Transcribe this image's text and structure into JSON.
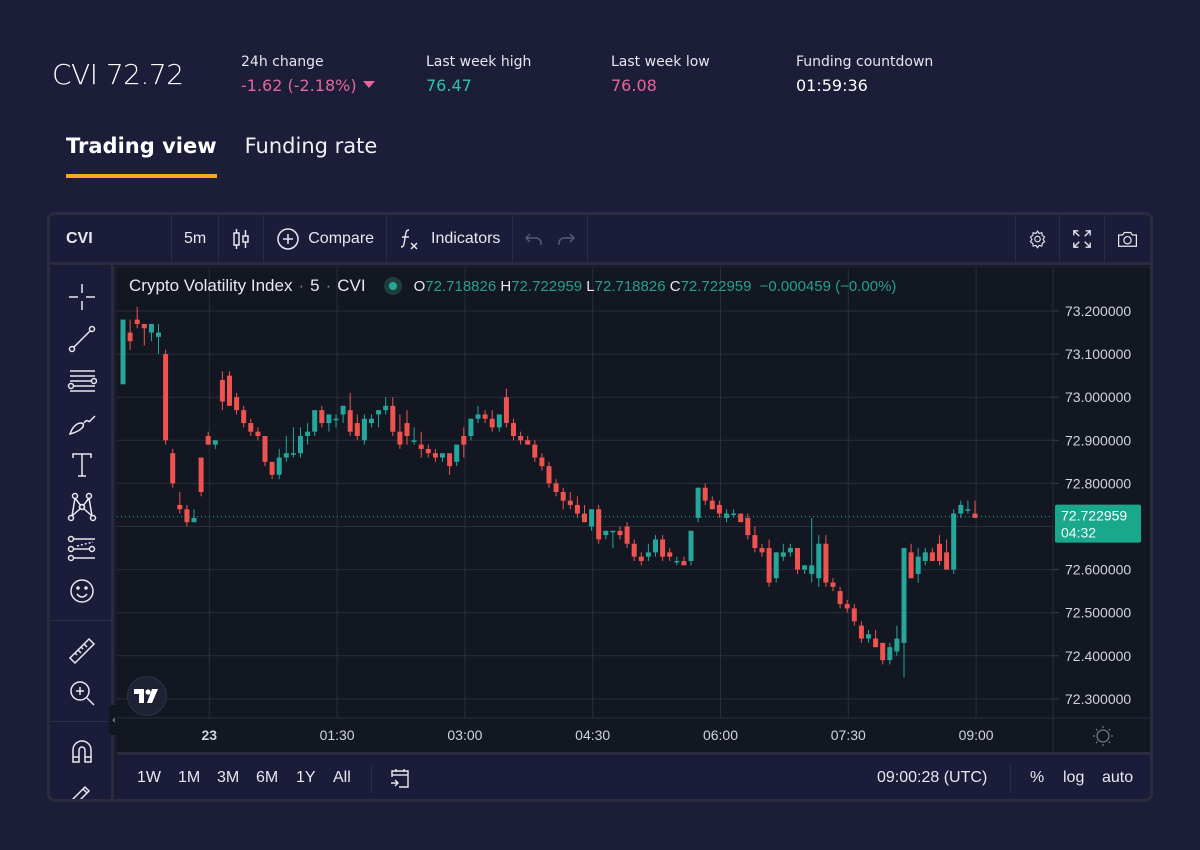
{
  "header": {
    "title": "CVI 72.72",
    "stats": [
      {
        "label": "24h change",
        "value": "-1.62 (-2.18%)",
        "trend": "down",
        "color": "#e6669a"
      },
      {
        "label": "Last week high",
        "value": "76.47",
        "color": "#2fc2a8"
      },
      {
        "label": "Last week low",
        "value": "76.08",
        "color": "#e6669a"
      },
      {
        "label": "Funding countdown",
        "value": "01:59:36",
        "color": "#ffffff"
      }
    ]
  },
  "tabs": [
    {
      "label": "Trading view",
      "active": true
    },
    {
      "label": "Funding rate",
      "active": false
    }
  ],
  "colors": {
    "accent": "#f6a623",
    "up": "#26a69a",
    "down": "#ef5350",
    "background": "#1c1d38",
    "plot": "#131722"
  },
  "toolbar": {
    "symbol": "CVI",
    "interval": "5m",
    "compare_label": "Compare",
    "indicators_label": "Indicators",
    "icons": [
      "candlestick-icon",
      "compare-plus-icon",
      "fx-icon",
      "undo-icon",
      "redo-icon",
      "settings-gear-icon",
      "fullscreen-icon",
      "camera-icon"
    ]
  },
  "left_tools": [
    "crosshair-icon",
    "trend-line-icon",
    "fib-lines-icon",
    "brush-icon",
    "text-icon",
    "pattern-icon",
    "prediction-icon",
    "emoji-icon",
    "ruler-icon",
    "zoom-in-icon",
    "magnet-icon",
    "pencil-lock-icon"
  ],
  "legend": {
    "name": "Crypto Volatility Index",
    "interval": "5",
    "symbol": "CVI",
    "o_label": "O",
    "o": "72.718826",
    "h_label": "H",
    "h": "72.722959",
    "l_label": "L",
    "l": "72.718826",
    "c_label": "C",
    "c": "72.722959",
    "change": "−0.000459 (−0.00%)"
  },
  "bottom": {
    "ranges": [
      "1W",
      "1M",
      "3M",
      "6M",
      "1Y",
      "All"
    ],
    "time": "09:00:28 (UTC)",
    "percent": "%",
    "log": "log",
    "auto": "auto"
  },
  "chart_data": {
    "type": "candlestick",
    "title": "Crypto Volatility Index · 5 · CVI",
    "ylim": [
      72.27,
      73.26
    ],
    "y_ticks": [
      "73.200000",
      "73.100000",
      "73.000000",
      "72.900000",
      "72.800000",
      "72.600000",
      "72.500000",
      "72.400000",
      "72.300000"
    ],
    "x_ticks": [
      {
        "label": "23",
        "bold": true,
        "bar": 13
      },
      {
        "label": "01:30",
        "bar": 31
      },
      {
        "label": "03:00",
        "bar": 49
      },
      {
        "label": "04:30",
        "bar": 67
      },
      {
        "label": "06:00",
        "bar": 85
      },
      {
        "label": "07:30",
        "bar": 103
      },
      {
        "label": "09:00",
        "bar": 121
      }
    ],
    "last_price": {
      "value": "72.722959",
      "countdown": "04:32",
      "price": 72.722959
    },
    "candles": [
      [
        73.03,
        73.17,
        73.05,
        73.18
      ],
      [
        73.15,
        73.18,
        73.11,
        73.13
      ],
      [
        73.18,
        73.21,
        73.16,
        73.17
      ],
      [
        73.17,
        73.15,
        73.12,
        73.16
      ],
      [
        73.15,
        73.16,
        73.13,
        73.17
      ],
      [
        73.14,
        73.17,
        73.1,
        73.15
      ],
      [
        73.1,
        73.11,
        72.89,
        72.9
      ],
      [
        72.87,
        72.88,
        72.79,
        72.8
      ],
      [
        72.75,
        72.78,
        72.73,
        72.74
      ],
      [
        72.74,
        72.75,
        72.7,
        72.71
      ],
      [
        72.71,
        72.74,
        72.73,
        72.72
      ],
      [
        72.86,
        72.86,
        72.77,
        72.78
      ],
      [
        72.91,
        72.92,
        72.9,
        72.89
      ],
      [
        72.89,
        72.9,
        72.88,
        72.9
      ],
      [
        73.04,
        73.06,
        72.97,
        72.99
      ],
      [
        73.05,
        73.06,
        73.01,
        72.98
      ],
      [
        73.0,
        73.01,
        72.96,
        72.97
      ],
      [
        72.97,
        72.98,
        72.93,
        72.94
      ],
      [
        72.94,
        72.95,
        72.91,
        72.92
      ],
      [
        72.92,
        72.93,
        72.9,
        72.91
      ],
      [
        72.91,
        72.91,
        72.84,
        72.85
      ],
      [
        72.85,
        72.85,
        72.81,
        72.82
      ],
      [
        72.82,
        72.88,
        72.81,
        72.86
      ],
      [
        72.86,
        72.91,
        72.85,
        72.87
      ],
      [
        72.87,
        72.93,
        72.86,
        72.87
      ],
      [
        72.87,
        72.93,
        72.86,
        72.91
      ],
      [
        72.91,
        72.94,
        72.89,
        72.92
      ],
      [
        72.92,
        72.96,
        72.91,
        72.97
      ],
      [
        72.97,
        72.98,
        72.93,
        72.94
      ],
      [
        72.94,
        72.96,
        72.92,
        72.96
      ],
      [
        72.95,
        72.96,
        72.93,
        72.95
      ],
      [
        72.96,
        72.97,
        72.94,
        72.98
      ],
      [
        72.97,
        73.01,
        72.91,
        72.92
      ],
      [
        72.94,
        72.96,
        72.9,
        72.91
      ],
      [
        72.9,
        72.96,
        72.89,
        72.95
      ],
      [
        72.94,
        72.96,
        72.93,
        72.95
      ],
      [
        72.96,
        72.97,
        72.93,
        72.97
      ],
      [
        72.97,
        73.0,
        72.96,
        72.98
      ],
      [
        72.98,
        73.0,
        72.91,
        72.92
      ],
      [
        72.92,
        72.96,
        72.88,
        72.89
      ],
      [
        72.94,
        72.97,
        72.89,
        72.91
      ],
      [
        72.9,
        72.93,
        72.89,
        72.9
      ],
      [
        72.89,
        72.92,
        72.86,
        72.88
      ],
      [
        72.88,
        72.89,
        72.86,
        72.87
      ],
      [
        72.87,
        72.88,
        72.85,
        72.86
      ],
      [
        72.86,
        72.87,
        72.85,
        72.87
      ],
      [
        72.87,
        72.87,
        72.82,
        72.84
      ],
      [
        72.85,
        72.88,
        72.84,
        72.89
      ],
      [
        72.91,
        72.93,
        72.86,
        72.89
      ],
      [
        72.91,
        72.95,
        72.9,
        72.95
      ],
      [
        72.95,
        72.98,
        72.94,
        72.96
      ],
      [
        72.96,
        72.97,
        72.94,
        72.95
      ],
      [
        72.95,
        72.97,
        72.92,
        72.93
      ],
      [
        72.93,
        72.96,
        72.92,
        72.96
      ],
      [
        73.0,
        73.02,
        72.93,
        72.94
      ],
      [
        72.94,
        72.95,
        72.9,
        72.91
      ],
      [
        72.91,
        72.92,
        72.89,
        72.9
      ],
      [
        72.9,
        72.91,
        72.89,
        72.89
      ],
      [
        72.89,
        72.9,
        72.85,
        72.86
      ],
      [
        72.86,
        72.87,
        72.83,
        72.84
      ],
      [
        72.84,
        72.85,
        72.79,
        72.8
      ],
      [
        72.8,
        72.81,
        72.77,
        72.78
      ],
      [
        72.78,
        72.79,
        72.74,
        72.76
      ],
      [
        72.76,
        72.78,
        72.74,
        72.75
      ],
      [
        72.75,
        72.77,
        72.72,
        72.73
      ],
      [
        72.73,
        72.75,
        72.71,
        72.71
      ],
      [
        72.7,
        72.74,
        72.69,
        72.74
      ],
      [
        72.74,
        72.75,
        72.66,
        72.67
      ],
      [
        72.68,
        72.69,
        72.67,
        72.69
      ],
      [
        72.69,
        72.69,
        72.65,
        72.69
      ],
      [
        72.69,
        72.7,
        72.67,
        72.68
      ],
      [
        72.7,
        72.71,
        72.65,
        72.66
      ],
      [
        72.66,
        72.67,
        72.62,
        72.63
      ],
      [
        72.63,
        72.64,
        72.61,
        72.62
      ],
      [
        72.63,
        72.66,
        72.62,
        72.64
      ],
      [
        72.64,
        72.68,
        72.63,
        72.67
      ],
      [
        72.67,
        72.68,
        72.62,
        72.63
      ],
      [
        72.64,
        72.65,
        72.62,
        72.63
      ],
      [
        72.62,
        72.63,
        72.61,
        72.62
      ],
      [
        72.62,
        72.63,
        72.61,
        72.61
      ],
      [
        72.62,
        72.69,
        72.61,
        72.69
      ],
      [
        72.72,
        72.79,
        72.71,
        72.79
      ],
      [
        72.79,
        72.8,
        72.75,
        72.76
      ],
      [
        72.76,
        72.77,
        72.74,
        72.74
      ],
      [
        72.75,
        72.76,
        72.72,
        72.73
      ],
      [
        72.72,
        72.74,
        72.71,
        72.73
      ],
      [
        72.73,
        72.74,
        72.72,
        72.73
      ],
      [
        72.73,
        72.73,
        72.71,
        72.71
      ],
      [
        72.72,
        72.73,
        72.67,
        72.68
      ],
      [
        72.68,
        72.7,
        72.64,
        72.65
      ],
      [
        72.65,
        72.66,
        72.63,
        72.64
      ],
      [
        72.65,
        72.67,
        72.56,
        72.57
      ],
      [
        72.58,
        72.64,
        72.57,
        72.64
      ],
      [
        72.63,
        72.66,
        72.62,
        72.64
      ],
      [
        72.64,
        72.66,
        72.63,
        72.65
      ],
      [
        72.65,
        72.65,
        72.59,
        72.6
      ],
      [
        72.6,
        72.61,
        72.59,
        72.61
      ],
      [
        72.59,
        72.72,
        72.57,
        72.61
      ],
      [
        72.58,
        72.68,
        72.56,
        72.66
      ],
      [
        72.66,
        72.68,
        72.56,
        72.57
      ],
      [
        72.57,
        72.58,
        72.55,
        72.56
      ],
      [
        72.55,
        72.56,
        72.51,
        72.52
      ],
      [
        72.52,
        72.53,
        72.5,
        72.51
      ],
      [
        72.51,
        72.52,
        72.47,
        72.48
      ],
      [
        72.47,
        72.48,
        72.43,
        72.44
      ],
      [
        72.44,
        72.46,
        72.43,
        72.45
      ],
      [
        72.44,
        72.46,
        72.43,
        72.42
      ],
      [
        72.43,
        72.43,
        72.38,
        72.39
      ],
      [
        72.39,
        72.43,
        72.38,
        72.42
      ],
      [
        72.41,
        72.47,
        72.4,
        72.44
      ],
      [
        72.43,
        72.63,
        72.35,
        72.65
      ],
      [
        72.64,
        72.66,
        72.58,
        72.58
      ],
      [
        72.59,
        72.65,
        72.57,
        72.63
      ],
      [
        72.62,
        72.65,
        72.61,
        72.64
      ],
      [
        72.64,
        72.65,
        72.62,
        72.62
      ],
      [
        72.66,
        72.68,
        72.61,
        72.62
      ],
      [
        72.64,
        72.67,
        72.61,
        72.6
      ],
      [
        72.6,
        72.74,
        72.59,
        72.73
      ],
      [
        72.73,
        72.76,
        72.72,
        72.75
      ],
      [
        72.74,
        72.76,
        72.73,
        72.74
      ],
      [
        72.73,
        72.76,
        72.72,
        72.72
      ]
    ]
  }
}
